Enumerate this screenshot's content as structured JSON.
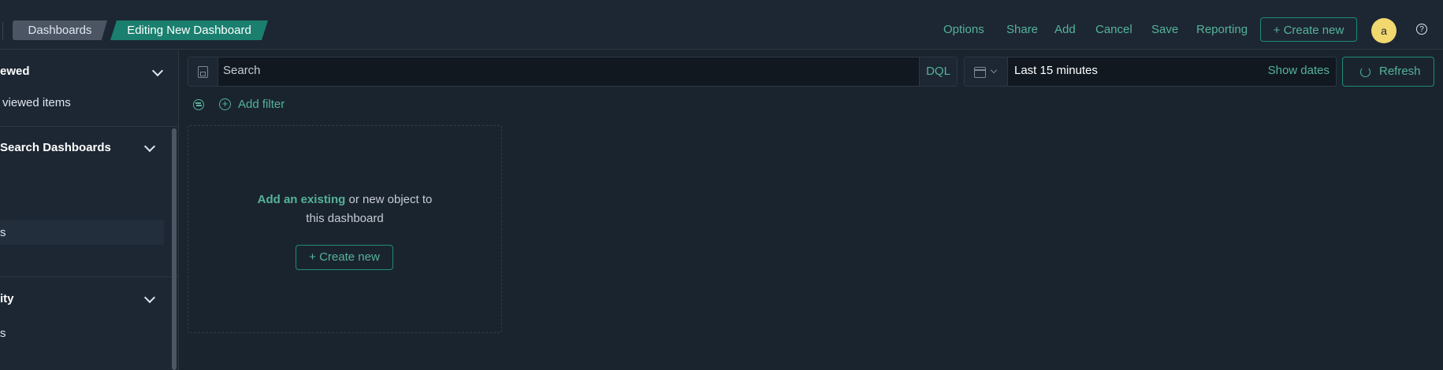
{
  "header": {
    "breadcrumbs": [
      "Dashboards",
      "Editing New Dashboard"
    ],
    "actions": {
      "options": "Options",
      "share": "Share",
      "add": "Add",
      "cancel": "Cancel",
      "save": "Save",
      "reporting": "Reporting"
    },
    "create_new": "+ Create new",
    "avatar_initial": "a",
    "help_icon": "?"
  },
  "sidebar": {
    "sections": [
      {
        "title": "ewed",
        "items": [
          "viewed items"
        ]
      },
      {
        "title": "Search Dashboards",
        "items": [
          "s"
        ]
      },
      {
        "title": "ity",
        "items": [
          "s"
        ]
      }
    ]
  },
  "query": {
    "placeholder": "Search",
    "language": "DQL",
    "time_range": "Last 15 minutes",
    "show_dates": "Show dates",
    "refresh": "Refresh",
    "add_filter": "Add filter"
  },
  "empty_panel": {
    "link": "Add an existing",
    "line1_rest": " or new object to",
    "line2": "this dashboard",
    "button": "+ Create new"
  },
  "colors": {
    "accent": "#54b399",
    "active_crumb": "#1a7f6f",
    "background": "#1a242f"
  }
}
